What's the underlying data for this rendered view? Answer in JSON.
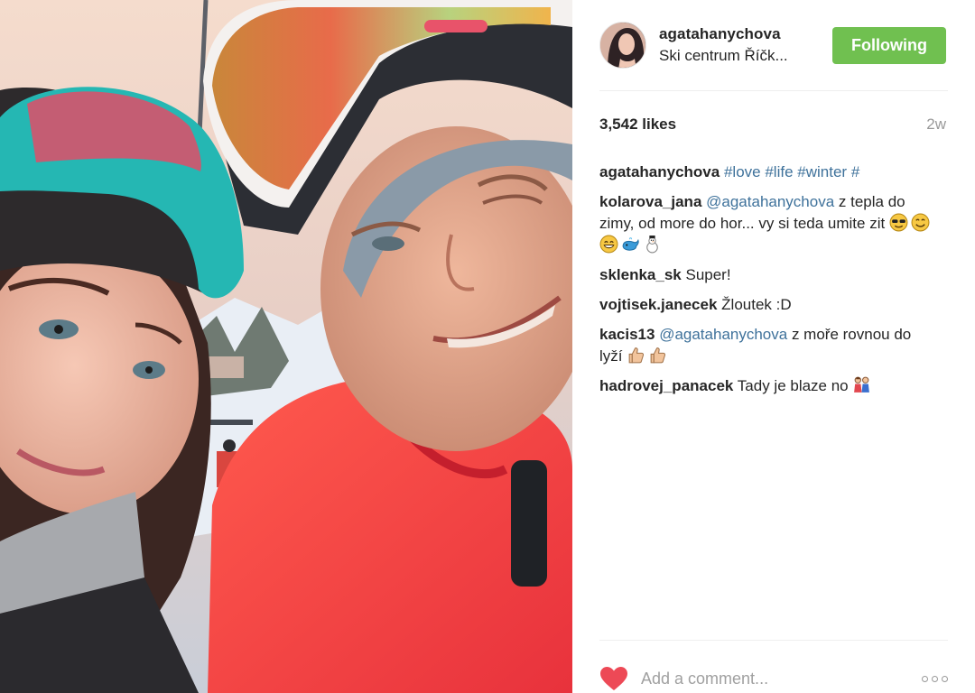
{
  "post": {
    "image_alt": "Selfie of two people on a ski lift wearing goggles and helmets",
    "colors": {
      "accent_follow": "#70c050",
      "link": "#3f729b",
      "like_heart": "#ed4956"
    }
  },
  "header": {
    "username": "agatahanychova",
    "location": "Ski centrum Říčk...",
    "follow_label": "Following"
  },
  "stats": {
    "likes": "3,542 likes",
    "age": "2w"
  },
  "caption": {
    "user": "agatahanychova",
    "tags": [
      "#love",
      "#life",
      "#winter",
      "#"
    ]
  },
  "comments": [
    {
      "user": "kolarova_jana",
      "mention": "@agatahanychova",
      "text": " z tepla do zimy, od more do hor... vy si teda umite zit",
      "emojis": [
        "sunglasses-face",
        "smiling-face",
        "grinning-face",
        "whale",
        "snowman"
      ]
    },
    {
      "user": "sklenka_sk",
      "text": "Super!"
    },
    {
      "user": "vojtisek.janecek",
      "text": "Žloutek :D"
    },
    {
      "user": "kacis13",
      "mention": "@agatahanychova",
      "text": " z moře rovnou do lyží",
      "emojis": [
        "thumbs-up",
        "thumbs-up"
      ]
    },
    {
      "user": "hadrovej_panacek",
      "text": "Tady je blaze no",
      "emojis": [
        "couple"
      ]
    }
  ],
  "footer": {
    "comment_placeholder": "Add a comment...",
    "icons": [
      "heart-icon",
      "more-options-icon"
    ]
  }
}
